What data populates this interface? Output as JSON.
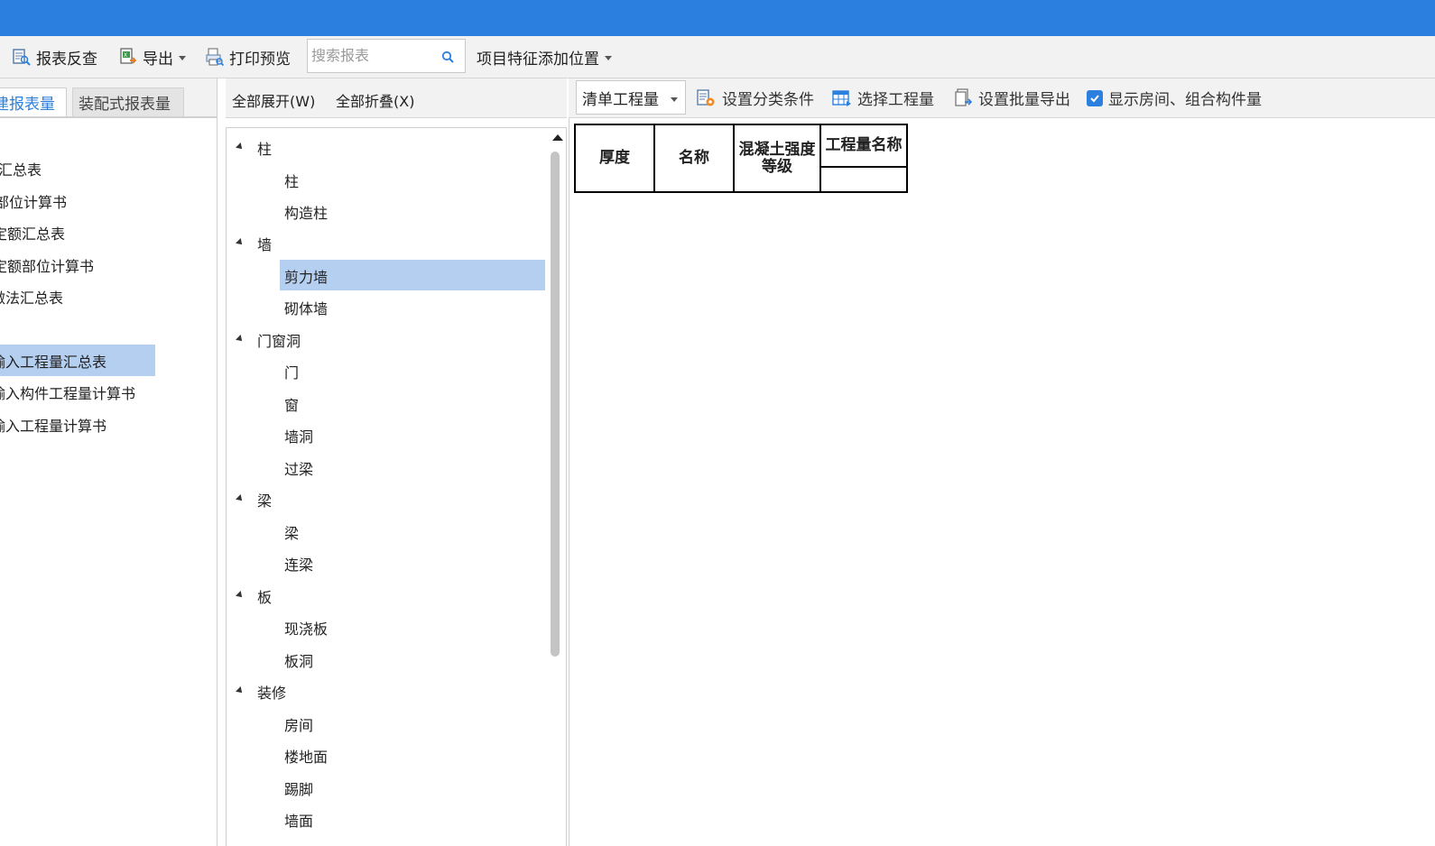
{
  "toolbar": {
    "report_check": "报表反查",
    "export": "导出",
    "print_preview": "打印预览",
    "search_placeholder": "搜索报表",
    "item_feature_position": "项目特征添加位置"
  },
  "left_panel": {
    "tabs": [
      {
        "label": "建报表量",
        "active": true
      },
      {
        "label": "装配式报表量",
        "active": false
      }
    ],
    "items": [
      {
        "label": "汇总表"
      },
      {
        "label": "部位计算书"
      },
      {
        "label": "定额汇总表"
      },
      {
        "label": "定额部位计算书"
      },
      {
        "label": "做法汇总表"
      },
      {
        "label": "输入工程量汇总表",
        "selected": true
      },
      {
        "label": "输入构件工程量计算书"
      },
      {
        "label": "输入工程量计算书"
      }
    ]
  },
  "middle_panel": {
    "expand_all": "全部展开(W)",
    "collapse_all": "全部折叠(X)",
    "tree": [
      {
        "label": "柱",
        "children": [
          "柱",
          "构造柱"
        ]
      },
      {
        "label": "墙",
        "children": [
          "剪力墙",
          "砌体墙"
        ],
        "selected_child": "剪力墙"
      },
      {
        "label": "门窗洞",
        "children": [
          "门",
          "窗",
          "墙洞",
          "过梁"
        ]
      },
      {
        "label": "梁",
        "children": [
          "梁",
          "连梁"
        ]
      },
      {
        "label": "板",
        "children": [
          "现浇板",
          "板洞"
        ]
      },
      {
        "label": "装修",
        "children": [
          "房间",
          "楼地面",
          "踢脚",
          "墙面"
        ]
      }
    ]
  },
  "right_panel": {
    "quantity_type": "清单工程量",
    "set_classification": "设置分类条件",
    "select_quantity": "选择工程量",
    "batch_export": "设置批量导出",
    "show_room_checkbox": {
      "label": "显示房间、组合构件量",
      "checked": true
    },
    "table_headers": [
      "厚度",
      "名称",
      "混凝土强度等级",
      "工程量名称"
    ]
  },
  "colors": {
    "titlebar": "#2b7fdf",
    "selection": "#b5cff0",
    "toolbar_bg": "#f2f2f2",
    "accent": "#2b7fdf"
  }
}
